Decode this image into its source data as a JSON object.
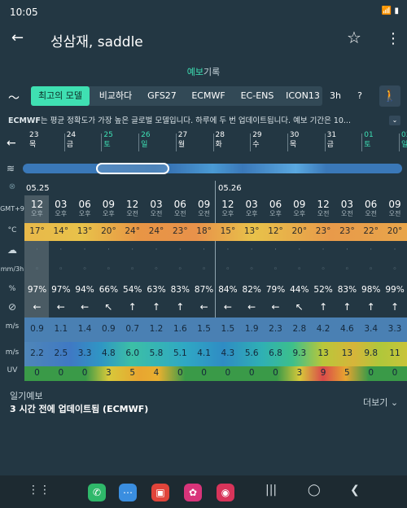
{
  "status": {
    "time": "10:05",
    "icons": "📶 ▮"
  },
  "appbar": {
    "title": "성삼재, saddle"
  },
  "subtitle": {
    "part1": "예보",
    "part2": "기록"
  },
  "tabs": {
    "items": [
      "최고의 모델",
      "비교하다",
      "GFS27",
      "ECMWF",
      "EC-ENS",
      "ICON13"
    ],
    "interval": "3h",
    "help": "?"
  },
  "description": {
    "model": "ECMWF",
    "text": "는 평균 정확도가 가장 높은 글로벌 모델입니다. 하루에 두 번 업데이트됩니다. 예보 기간은 10..."
  },
  "days": [
    {
      "n": "23",
      "w": "목",
      "green": false
    },
    {
      "n": "24",
      "w": "금",
      "green": false
    },
    {
      "n": "25",
      "w": "토",
      "green": true
    },
    {
      "n": "26",
      "w": "일",
      "green": true
    },
    {
      "n": "27",
      "w": "월",
      "green": false
    },
    {
      "n": "28",
      "w": "화",
      "green": false
    },
    {
      "n": "29",
      "w": "수",
      "green": false
    },
    {
      "n": "30",
      "w": "목",
      "green": false
    },
    {
      "n": "31",
      "w": "금",
      "green": false
    },
    {
      "n": "01",
      "w": "토",
      "green": true
    },
    {
      "n": "02",
      "w": "일",
      "green": true
    }
  ],
  "grid": {
    "date1": "05.25",
    "date2": "05.26",
    "labels": {
      "tz": "GMT+9",
      "temp": "°C",
      "rain": "mm/3h",
      "hum": "%",
      "wind": "m/s",
      "gust": "m/s",
      "uv": "UV"
    },
    "hours": [
      "12",
      "03",
      "06",
      "09",
      "12",
      "03",
      "06",
      "09",
      "12",
      "03",
      "06",
      "09",
      "12",
      "03",
      "06",
      "09"
    ],
    "ampm": [
      "오후",
      "오후",
      "오후",
      "오후",
      "오전",
      "오전",
      "오전",
      "오전",
      "오후",
      "오후",
      "오후",
      "오후",
      "오전",
      "오전",
      "오전",
      "오전"
    ],
    "temps": [
      "17°",
      "14°",
      "13°",
      "20°",
      "24°",
      "24°",
      "23°",
      "18°",
      "15°",
      "13°",
      "12°",
      "20°",
      "23°",
      "23°",
      "22°",
      "20°"
    ],
    "humidity": [
      "97%",
      "97%",
      "94%",
      "66%",
      "54%",
      "63%",
      "83%",
      "87%",
      "84%",
      "82%",
      "79%",
      "44%",
      "52%",
      "83%",
      "98%",
      "99%"
    ],
    "arrows": [
      "←",
      "←",
      "←",
      "↖",
      "↑",
      "↑",
      "↑",
      "←",
      "←",
      "←",
      "←",
      "↖",
      "↑",
      "↑",
      "↑",
      "↑"
    ],
    "wind": [
      "0.9",
      "1.1",
      "1.4",
      "0.9",
      "0.7",
      "1.2",
      "1.6",
      "1.5",
      "1.5",
      "1.9",
      "2.3",
      "2.8",
      "4.2",
      "4.6",
      "3.4",
      "3.3"
    ],
    "gust": [
      "2.2",
      "2.5",
      "3.3",
      "4.8",
      "6.0",
      "5.8",
      "5.1",
      "4.1",
      "4.3",
      "5.6",
      "6.8",
      "9.3",
      "13",
      "13",
      "9.8",
      "11"
    ],
    "uv": [
      "0",
      "0",
      "0",
      "3",
      "5",
      "4",
      "0",
      "0",
      "0",
      "0",
      "0",
      "3",
      "9",
      "5",
      "0",
      "0"
    ]
  },
  "colors": {
    "temp": [
      "#e9b84a",
      "#e8c24a",
      "#e8c24a",
      "#e8a54a",
      "#e78a45",
      "#e78a45",
      "#e8924a",
      "#e8b54a",
      "#e8c04a",
      "#e8c24a",
      "#e8c24a",
      "#e8a54a",
      "#e8924a",
      "#e8924a",
      "#e89a4a",
      "#e8a54a"
    ],
    "wind": [
      "#4f86b8",
      "#4f86b8",
      "#4f86b8",
      "#4f86b8",
      "#4f86b8",
      "#4f86b8",
      "#4f86b8",
      "#4f86b8",
      "#4f86b8",
      "#4f86b8",
      "#4f86b8",
      "#4f86b8",
      "#3f7fc4",
      "#3f7fc4",
      "#4f86b8",
      "#4f86b8"
    ],
    "gust": [
      "#4f86b8",
      "#4f86b8",
      "#3f79c4",
      "#2f96c4",
      "#3cbfa6",
      "#3cbf9e",
      "#2fa8c4",
      "#2f8cc4",
      "#2f8cc4",
      "#2fb0b4",
      "#3cbf8c",
      "#b9c73a",
      "#d6b53a",
      "#d6b53a",
      "#b0c73a",
      "#c8c43a"
    ],
    "uv": [
      "#3a9a48",
      "#3a9a48",
      "#3a9a48",
      "#d8c93a",
      "#e8a530",
      "#e8b030",
      "#3a9a48",
      "#3a9a48",
      "#3a9a48",
      "#3a9a48",
      "#3a9a48",
      "#d8c93a",
      "#d94a4a",
      "#e8a530",
      "#3a9a48",
      "#3a9a48"
    ]
  },
  "footer": {
    "label": "일기예보",
    "update": "3 시간 전에 업데이트됨 (ECMWF)",
    "more": "더보기 ⌄"
  }
}
